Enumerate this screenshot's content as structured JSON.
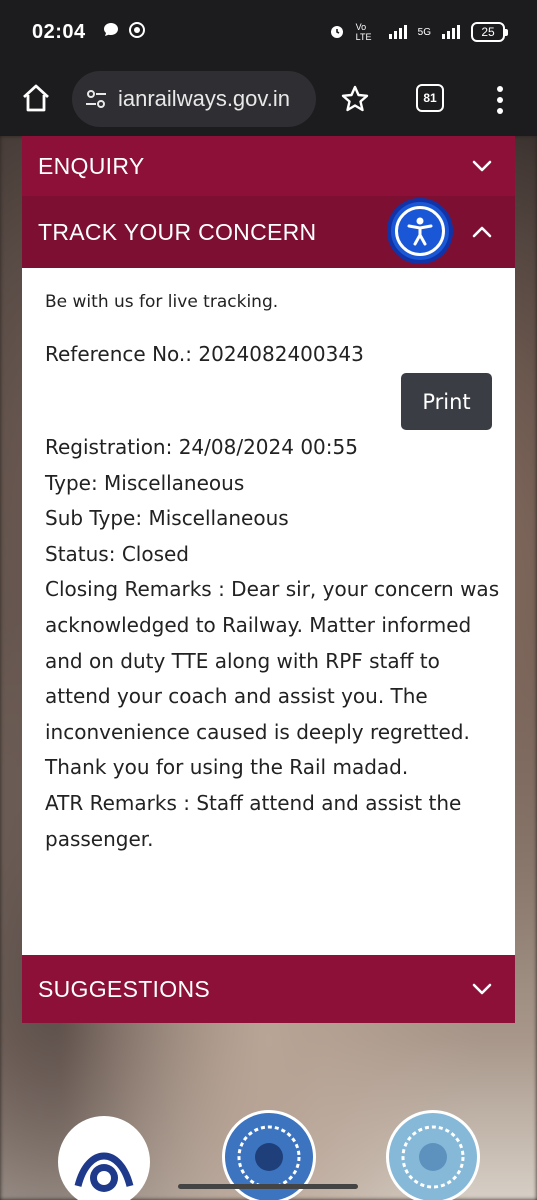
{
  "status_bar": {
    "time": "02:04",
    "battery": "25",
    "network": "5G",
    "volte": "Vo LTE"
  },
  "browser": {
    "url": "ianrailways.gov.in",
    "tab_count": "81"
  },
  "accordion": {
    "enquiry_label": "ENQUIRY",
    "track_label": "TRACK YOUR CONCERN",
    "suggestions_label": "SUGGESTIONS"
  },
  "track": {
    "tagline": "Be with us for live tracking.",
    "reference": "Reference No.: 2024082400343",
    "print_label": "Print",
    "registration": "Registration: 24/08/2024 00:55",
    "type": "Type: Miscellaneous",
    "sub_type": "Sub Type: Miscellaneous",
    "status": "Status: Closed",
    "closing_remarks": "Closing Remarks : Dear sir, your concern was acknowledged to Railway. Matter informed and on duty TTE along with RPF staff to attend your coach and assist you. The inconvenience caused is deeply regretted. Thank you for using the Rail madad.",
    "atr_remarks": "ATR Remarks : Staff attend and assist the passenger."
  },
  "colors": {
    "accordion_bg": "#8c1038",
    "accessibility_blue": "#1a57d6",
    "print_bg": "#3a3e44"
  },
  "icons": [
    "home-icon",
    "site-settings-icon",
    "star-icon",
    "tabs-icon",
    "more-vert-icon",
    "chevron-down-icon",
    "chevron-up-icon",
    "accessibility-icon"
  ]
}
